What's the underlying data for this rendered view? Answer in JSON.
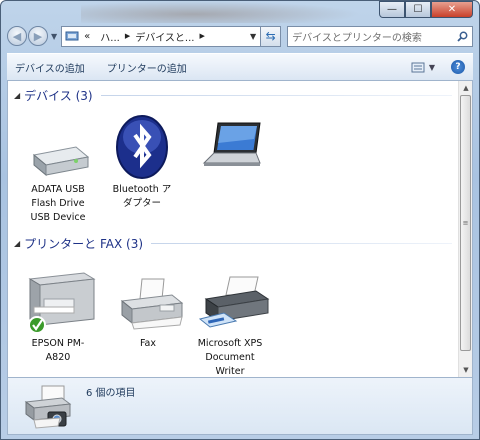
{
  "window": {
    "caption_buttons": {
      "minimize": "—",
      "maximize": "☐",
      "close": "✕"
    }
  },
  "navbar": {
    "back_icon": "back-arrow-icon",
    "forward_icon": "forward-arrow-icon",
    "breadcrumb": [
      "«",
      "ハ...",
      "デバイスと..."
    ],
    "search_placeholder": "デバイスとプリンターの検索"
  },
  "toolbar": {
    "add_device": "デバイスの追加",
    "add_printer": "プリンターの追加"
  },
  "groups": [
    {
      "title": "デバイス (3)",
      "items": [
        {
          "label": "ADATA USB Flash Drive USB Device",
          "icon": "usb-drive-icon"
        },
        {
          "label": "Bluetooth アダプター",
          "icon": "bluetooth-icon"
        },
        {
          "label": "",
          "icon": "laptop-icon"
        }
      ]
    },
    {
      "title": "プリンターと FAX (3)",
      "items": [
        {
          "label": "EPSON PM-A820",
          "icon": "multifunction-printer-icon"
        },
        {
          "label": "Fax",
          "icon": "fax-icon"
        },
        {
          "label": "Microsoft XPS Document Writer",
          "icon": "printer-icon"
        }
      ]
    }
  ],
  "details": {
    "count": "6 個の項目"
  }
}
